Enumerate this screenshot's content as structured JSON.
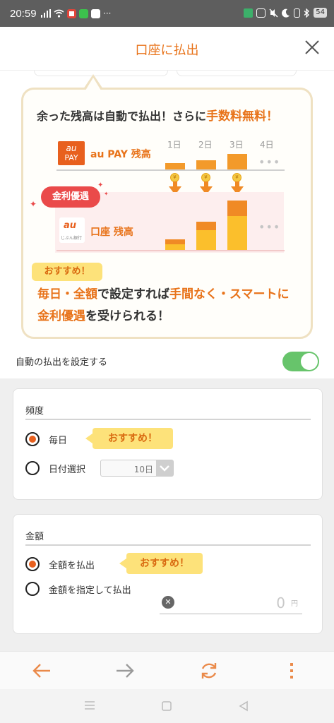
{
  "status_bar": {
    "time": "20:59",
    "more": "···",
    "battery": "54"
  },
  "header": {
    "title": "口座に払出",
    "close_icon": "close-icon"
  },
  "promo": {
    "headline_prefix": "余った残高は自動で払出！さらに",
    "headline_highlight": "手数料無料！",
    "days": [
      "1日",
      "2日",
      "3日",
      "4日"
    ],
    "more_dots": "•••",
    "au_pay_logo_top": "au",
    "au_pay_logo_bottom": "PAY",
    "au_pay_label": "au PAY 残高",
    "kinri_badge": "金利優遇",
    "coin_symbol": "¥",
    "jibun_logo_au": "au",
    "jibun_logo_text": "じぶん銀行",
    "koza_label": "口座 残高",
    "osusume_tag": "おすすめ！",
    "line1_a": "毎日・全額",
    "line1_b": "で設定すれば",
    "line1_c": "手間なく・スマートに",
    "line2_a": "金利優遇",
    "line2_b": "を受けられる！",
    "colors": {
      "accent": "#e8731a",
      "badge": "#ea4a4a",
      "bar": "#f39a2a",
      "bar_light": "#fbbf2c"
    }
  },
  "auto_toggle": {
    "label": "自動の払出を設定する",
    "enabled": true,
    "color": "#67c46b"
  },
  "frequency": {
    "title": "頻度",
    "option_daily": "毎日",
    "option_daily_selected": true,
    "daily_callout": "おすすめ！",
    "option_date": "日付選択",
    "date_value": "10日"
  },
  "amount": {
    "title": "金額",
    "option_all": "全額を払出",
    "option_all_selected": true,
    "all_callout": "おすすめ！",
    "option_specify": "金額を指定して払出",
    "clear_symbol": "✕",
    "value": "0",
    "unit": "円"
  },
  "bottom_nav": {
    "back_icon": "arrow-left-icon",
    "forward_icon": "arrow-right-icon",
    "refresh_icon": "refresh-icon",
    "menu_icon": "more-vertical-icon"
  }
}
